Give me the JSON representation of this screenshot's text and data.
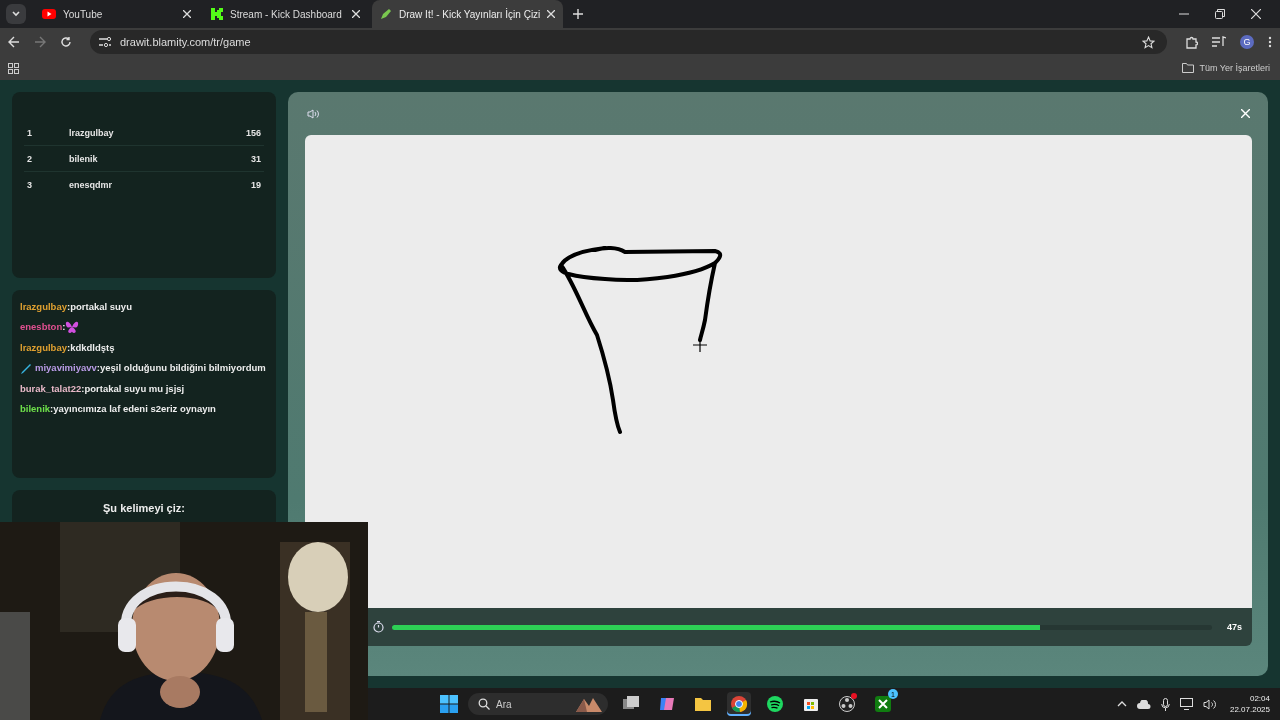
{
  "browser": {
    "tabs": [
      {
        "title": "YouTube",
        "kind": "youtube",
        "selected": false
      },
      {
        "title": "Stream - Kick Dashboard",
        "kind": "kick",
        "selected": false
      },
      {
        "title": "Draw It! - Kick Yayınları İçin Çizi",
        "kind": "drawit",
        "selected": true
      }
    ],
    "address": "drawit.blamity.com/tr/game",
    "profile": "G",
    "bookmarks_all": "Tüm Yer İşaretleri"
  },
  "leaderboard": [
    {
      "rank": "1",
      "name": "lrazgulbay",
      "score": "156"
    },
    {
      "rank": "2",
      "name": "bilenik",
      "score": "31"
    },
    {
      "rank": "3",
      "name": "enesqdmr",
      "score": "19"
    }
  ],
  "chat": [
    {
      "user": "lrazgulbay",
      "color": "#e0a030",
      "kind": "text",
      "text": ":portakal suyu",
      "badge": false
    },
    {
      "user": "enesbton",
      "color": "#e05090",
      "kind": "emote",
      "text": ":",
      "badge": false
    },
    {
      "user": "lrazgulbay",
      "color": "#e0a030",
      "kind": "text",
      "text": ":kdkdldştş",
      "badge": false
    },
    {
      "user": "miyavimiyavv",
      "color": "#b99be6",
      "kind": "text",
      "text": ":yeşil olduğunu bildiğini bilmiyordum",
      "badge": true
    },
    {
      "user": "burak_talat22",
      "color": "#e8b9c8",
      "kind": "text",
      "text": ":portakal suyu mu jsjsj",
      "badge": false
    },
    {
      "user": "bilenik",
      "color": "#6ee04a",
      "kind": "text",
      "text": ":yayıncımıza laf edeni s2eriz oynayın",
      "badge": false
    }
  ],
  "word_prompt": "Şu kelimeyi çiz:",
  "game": {
    "timer": "47s",
    "level": 0.79
  },
  "taskbar": {
    "search_placeholder": "Ara",
    "apps": [
      {
        "kind": "taskview",
        "selected": false,
        "notification": false
      },
      {
        "kind": "copilot",
        "selected": false,
        "notification": false
      },
      {
        "kind": "folder",
        "selected": false,
        "notification": false
      },
      {
        "kind": "chrome",
        "selected": true,
        "notification": false
      },
      {
        "kind": "spotify",
        "selected": false,
        "notification": false
      },
      {
        "kind": "store",
        "selected": false,
        "notification": false
      },
      {
        "kind": "obs",
        "selected": false,
        "notification": true
      },
      {
        "kind": "xbox",
        "selected": false,
        "notification": false,
        "badge": "1"
      }
    ],
    "time": "02:04",
    "date": "22.07.2025"
  }
}
